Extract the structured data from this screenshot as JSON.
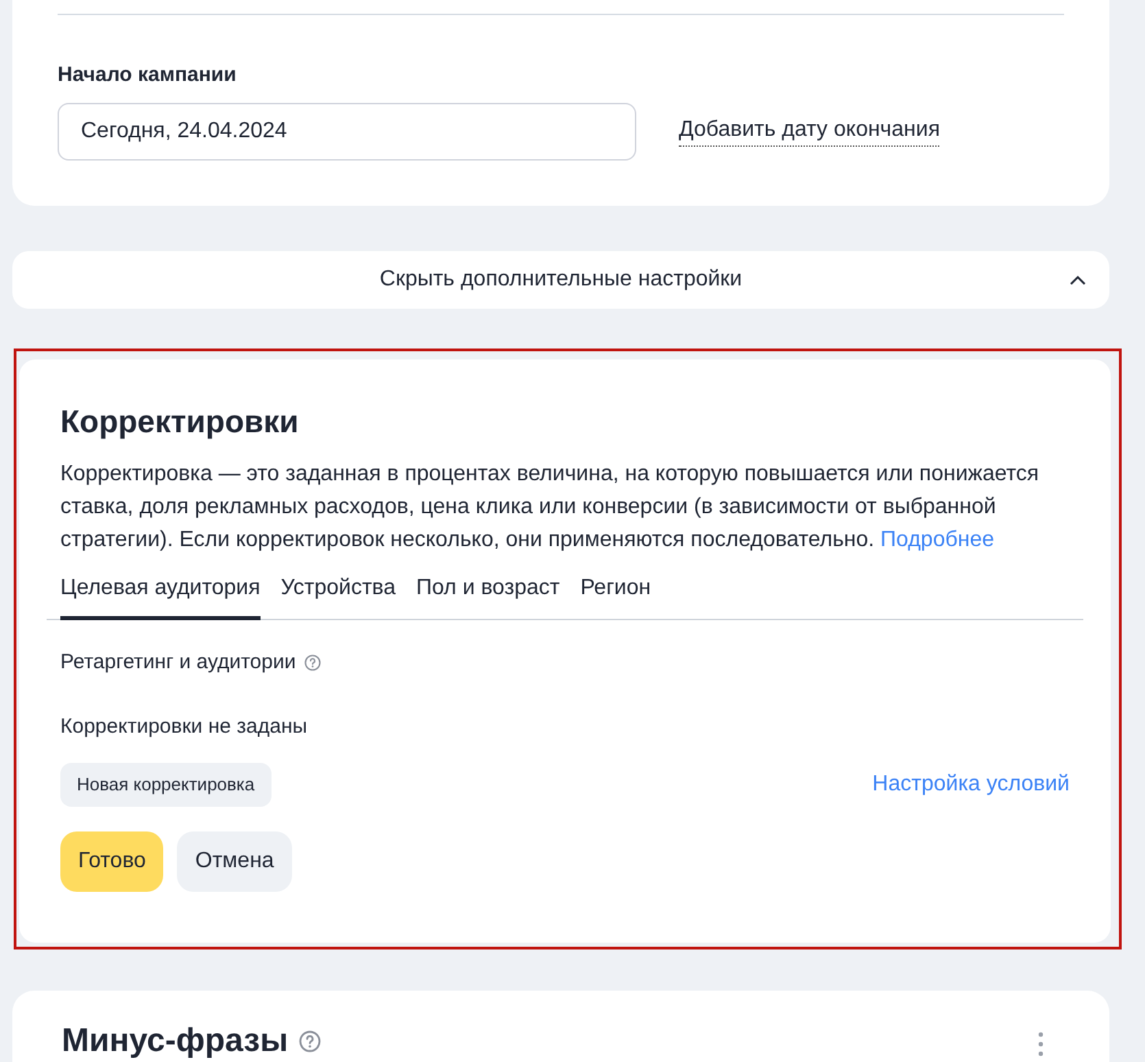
{
  "start_section": {
    "label": "Начало кампании",
    "date_value": "Сегодня, 24.04.2024",
    "end_date_link": "Добавить дату окончания"
  },
  "toggle_bar": {
    "label": "Скрыть дополнительные настройки",
    "expanded": true
  },
  "adjustments": {
    "highlighted": true,
    "title": "Корректировки",
    "description": "Корректировка — это заданная в процентах величина, на которую повышается или понижается ставка, доля рекламных расходов, цена клика или конверсии (в зависимости от выбранной стратегии). Если корректировок несколько, они применяются последовательно.",
    "more_link": "Подробнее",
    "tabs": [
      {
        "label": "Целевая аудитория",
        "selected": true
      },
      {
        "label": "Устройства",
        "selected": false
      },
      {
        "label": "Пол и возраст",
        "selected": false
      },
      {
        "label": "Регион",
        "selected": false
      }
    ],
    "subsection_title": "Ретаргетинг и аудитории",
    "empty_text": "Корректировки не заданы",
    "new_button": "Новая корректировка",
    "conditions_link": "Настройка условий",
    "done_button": "Готово",
    "cancel_button": "Отмена"
  },
  "negative_phrases": {
    "title": "Минус-фразы"
  }
}
